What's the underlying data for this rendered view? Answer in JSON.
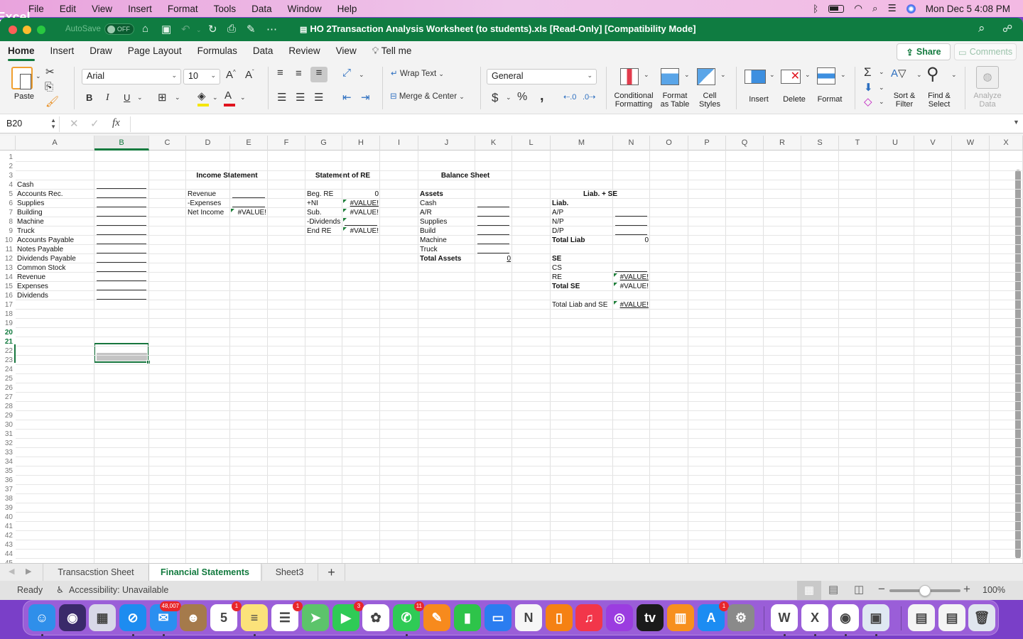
{
  "menubar": {
    "app_name": "Excel",
    "items": [
      "File",
      "Edit",
      "View",
      "Insert",
      "Format",
      "Tools",
      "Data",
      "Window",
      "Help"
    ],
    "clock": "Mon Dec 5  4:08 PM",
    "status_icons": [
      "bluetooth-icon",
      "battery-icon",
      "wifi-icon",
      "spotlight-icon",
      "control-center-icon",
      "siri-icon"
    ]
  },
  "titlebar": {
    "autosave_label": "AutoSave",
    "autosave_state": "OFF",
    "document_title": "HO 2Transaction Analysis Worksheet (to students).xls  [Read-Only]  [Compatibility Mode]"
  },
  "ribbon_tabs": {
    "items": [
      "Home",
      "Insert",
      "Draw",
      "Page Layout",
      "Formulas",
      "Data",
      "Review",
      "View"
    ],
    "active": "Home",
    "tell_me": "Tell me",
    "share": "Share",
    "comments": "Comments"
  },
  "ribbon": {
    "paste": "Paste",
    "font_name": "Arial",
    "font_size": "10",
    "bold": "B",
    "italic": "I",
    "underline": "U",
    "wrap_text": "Wrap Text",
    "merge_center": "Merge & Center",
    "number_format": "General",
    "currency": "$",
    "percent": "%",
    "comma": ",",
    "conditional_formatting": [
      "Conditional",
      "Formatting"
    ],
    "format_as_table": [
      "Format",
      "as Table"
    ],
    "cell_styles": [
      "Cell",
      "Styles"
    ],
    "insert": "Insert",
    "delete": "Delete",
    "format": "Format",
    "sort_filter": [
      "Sort &",
      "Filter"
    ],
    "find_select": [
      "Find &",
      "Select"
    ],
    "analyze_data": [
      "Analyze",
      "Data"
    ],
    "fill_color": "#f5e60a",
    "font_color": "#e0141e"
  },
  "formula_bar": {
    "name_box": "B20",
    "fx": "fx",
    "content": ""
  },
  "grid": {
    "columns": [
      "A",
      "B",
      "C",
      "D",
      "E",
      "F",
      "G",
      "H",
      "I",
      "J",
      "K",
      "L",
      "M",
      "N",
      "O",
      "P",
      "Q",
      "R",
      "S",
      "T",
      "U",
      "V",
      "W",
      "X"
    ],
    "selected_column": "B",
    "selected_rows": [
      20,
      21
    ],
    "row_count": 45,
    "accounts": {
      "labels": [
        "Cash",
        "Accounts Rec.",
        "Supplies",
        "Building",
        "Machine",
        "Truck",
        "Accounts Payable",
        "Notes Payable",
        "Dividends Payable",
        "Common Stock",
        "Revenue",
        "Expenses",
        "Dividends"
      ],
      "blank_placeholder": "________"
    },
    "income_statement": {
      "title": "Income Statement",
      "rows": [
        {
          "label": "Revenue",
          "value": ""
        },
        {
          "label": "-Expenses",
          "value": ""
        },
        {
          "label": "Net Income",
          "value": "#VALUE!"
        }
      ]
    },
    "statement_of_re": {
      "title": "Statement of RE",
      "rows": [
        {
          "label": "Beg. RE",
          "value": "0"
        },
        {
          "label": "+NI",
          "value": "#VALUE!"
        },
        {
          "label": "Sub.",
          "value": "#VALUE!"
        },
        {
          "label": "-Dividends",
          "value": ""
        },
        {
          "label": "End RE",
          "value": "#VALUE!"
        }
      ]
    },
    "balance_sheet": {
      "title": "Balance Sheet",
      "assets_header": "Assets",
      "assets": [
        "Cash",
        "A/R",
        "Supplies",
        "Build",
        "Machine",
        "Truck"
      ],
      "total_assets_label": "Total Assets",
      "total_assets_value": "0",
      "liab_se_header": "Liab. + SE",
      "liab_header": "Liab.",
      "liabilities": [
        "A/P",
        "N/P",
        "D/P"
      ],
      "total_liab_label": "Total Liab",
      "total_liab_value": "0",
      "se_header": "SE",
      "cs_label": "CS",
      "re_label": "RE",
      "re_value": "#VALUE!",
      "total_se_label": "Total SE",
      "total_se_value": "#VALUE!",
      "total_liab_se_label": "Total Liab and SE",
      "total_liab_se_value": "#VALUE!"
    }
  },
  "sheet_tabs": {
    "items": [
      "Transacstion Sheet",
      "Financial Statements",
      "Sheet3"
    ],
    "active": "Financial Statements",
    "add": "+"
  },
  "status_bar": {
    "ready": "Ready",
    "accessibility": "Accessibility: Unavailable",
    "zoom": "100%",
    "zoom_fraction": 0.5
  },
  "dock": {
    "apps": [
      {
        "name": "finder",
        "glyph": "☺",
        "color": "#2f8fea",
        "dot": true
      },
      {
        "name": "siri",
        "glyph": "◉",
        "color": "#3a2a6a"
      },
      {
        "name": "launchpad",
        "glyph": "▦",
        "color": "#d8d8e8"
      },
      {
        "name": "safari",
        "glyph": "⊘",
        "color": "#1d8cf0",
        "dot": true
      },
      {
        "name": "mail",
        "glyph": "✉",
        "color": "#2b8ff0",
        "badge": "48,007",
        "dot": true
      },
      {
        "name": "contacts",
        "glyph": "☻",
        "color": "#a57a4b"
      },
      {
        "name": "calendar",
        "glyph": "5",
        "color": "#ffffff",
        "badge": "1"
      },
      {
        "name": "notes",
        "glyph": "≡",
        "color": "#fbe27a",
        "dot": true
      },
      {
        "name": "reminders",
        "glyph": "☰",
        "color": "#ffffff",
        "badge": "1"
      },
      {
        "name": "maps",
        "glyph": "➤",
        "color": "#5cc46b"
      },
      {
        "name": "facetime",
        "glyph": "▶",
        "color": "#2fcb56",
        "badge": "3"
      },
      {
        "name": "photos",
        "glyph": "✿",
        "color": "#ffffff"
      },
      {
        "name": "messages",
        "glyph": "✆",
        "color": "#2fcb56",
        "badge": "11",
        "dot": true
      },
      {
        "name": "pages",
        "glyph": "✎",
        "color": "#f78a1d"
      },
      {
        "name": "numbers",
        "glyph": "▮",
        "color": "#2ec44a"
      },
      {
        "name": "keynote",
        "glyph": "▭",
        "color": "#2b7df0"
      },
      {
        "name": "news",
        "glyph": "N",
        "color": "#f6f6f6"
      },
      {
        "name": "books-bookmark",
        "glyph": "▯",
        "color": "#f58113"
      },
      {
        "name": "music",
        "glyph": "♫",
        "color": "#f2364a"
      },
      {
        "name": "podcasts",
        "glyph": "◎",
        "color": "#9b3de0"
      },
      {
        "name": "apple-tv",
        "glyph": "tv",
        "color": "#1b1b1b"
      },
      {
        "name": "books",
        "glyph": "▥",
        "color": "#f7901e"
      },
      {
        "name": "app-store",
        "glyph": "A",
        "color": "#1c8cf2",
        "badge": "1"
      },
      {
        "name": "system-preferences",
        "glyph": "⚙",
        "color": "#8a8a8a"
      },
      {
        "name": "word",
        "glyph": "W",
        "color": "#ffffff",
        "dot": true
      },
      {
        "name": "excel",
        "glyph": "X",
        "color": "#ffffff",
        "dot": true
      },
      {
        "name": "chrome",
        "glyph": "◉",
        "color": "#ffffff",
        "dot": true
      },
      {
        "name": "preview",
        "glyph": "▣",
        "color": "#dfe8f2",
        "dot": true
      },
      {
        "name": "document-thumbnail",
        "glyph": "▤",
        "color": "#f4f4f4"
      },
      {
        "name": "webpage-thumbnail",
        "glyph": "▤",
        "color": "#f4f4f4"
      },
      {
        "name": "trash",
        "glyph": "🗑",
        "color": "#e0e6ee"
      }
    ]
  }
}
